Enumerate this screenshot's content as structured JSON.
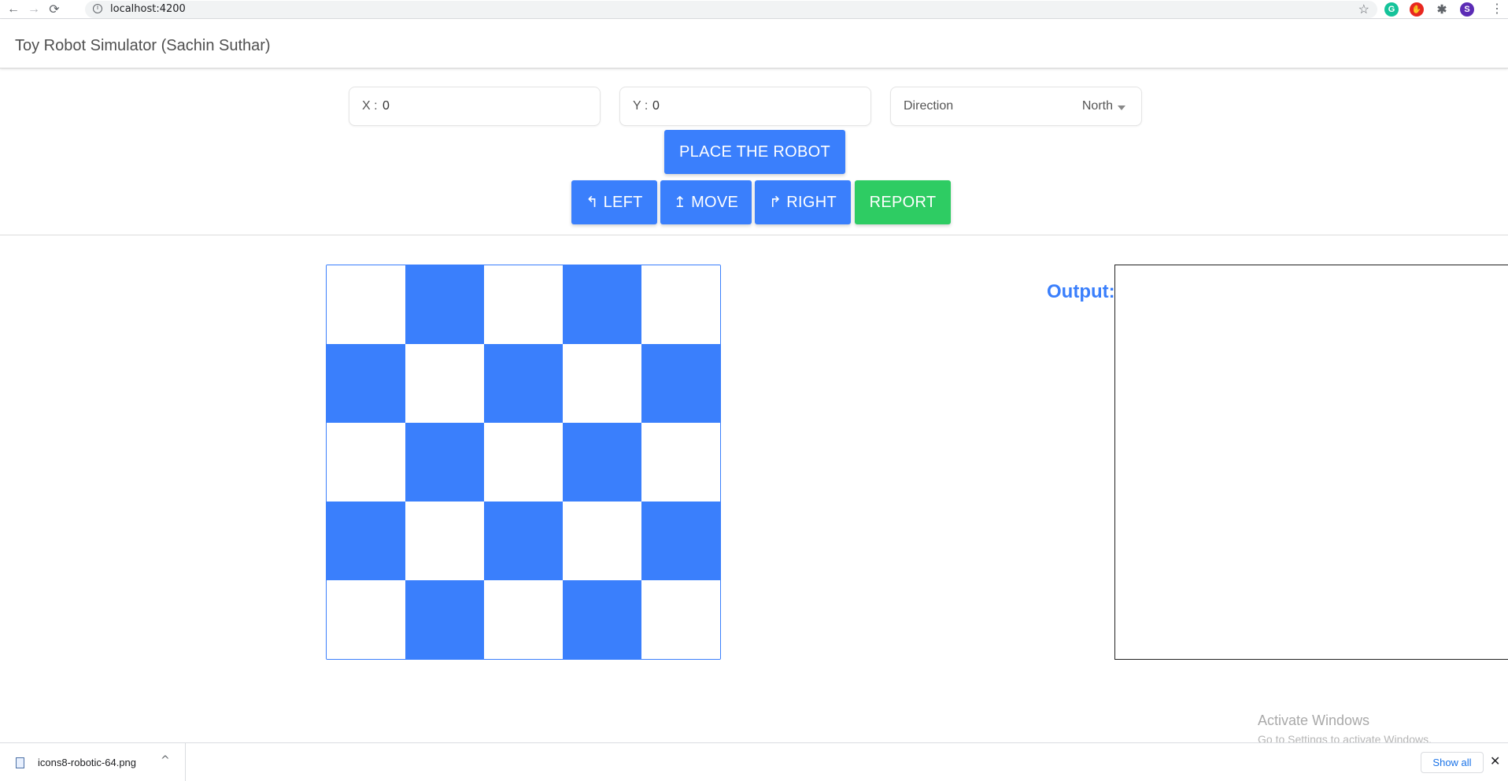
{
  "browser": {
    "url": "localhost:4200",
    "back_icon": "←",
    "forward_icon": "→",
    "reload_icon": "⟳",
    "info_icon": "i",
    "star_icon": "☆",
    "extensions": [
      {
        "name": "grammarly",
        "glyph": "G",
        "color": "#15c39a"
      },
      {
        "name": "adblock",
        "glyph": "✋",
        "color": "#e8271f"
      },
      {
        "name": "extensions-puzzle",
        "glyph": "✱",
        "color": "#5f6368"
      },
      {
        "name": "profile",
        "glyph": "S",
        "color": "#5b2bb5"
      }
    ],
    "menu_icon": "⋮"
  },
  "header": {
    "title": "Toy Robot Simulator (Sachin Suthar)"
  },
  "form": {
    "x_label": "X :",
    "x_value": "0",
    "y_label": "Y :",
    "y_value": "0",
    "direction_label": "Direction",
    "direction_value": "North"
  },
  "buttons": {
    "place": "PLACE THE ROBOT",
    "left_glyph": "↰",
    "left": "LEFT",
    "move_glyph": "↥",
    "move": "MOVE",
    "right_glyph": "↱",
    "right": "RIGHT",
    "report": "REPORT"
  },
  "board": {
    "rows": 5,
    "cols": 5,
    "colors": {
      "blue": "#3a7ffc",
      "white": "#ffffff"
    }
  },
  "output": {
    "label": "Output:",
    "content": ""
  },
  "watermark": {
    "title": "Activate Windows",
    "subtitle": "Go to Settings to activate Windows."
  },
  "downloads": {
    "filename": "icons8-robotic-64.png",
    "chevron": "^",
    "show_all": "Show all",
    "close": "✕"
  }
}
